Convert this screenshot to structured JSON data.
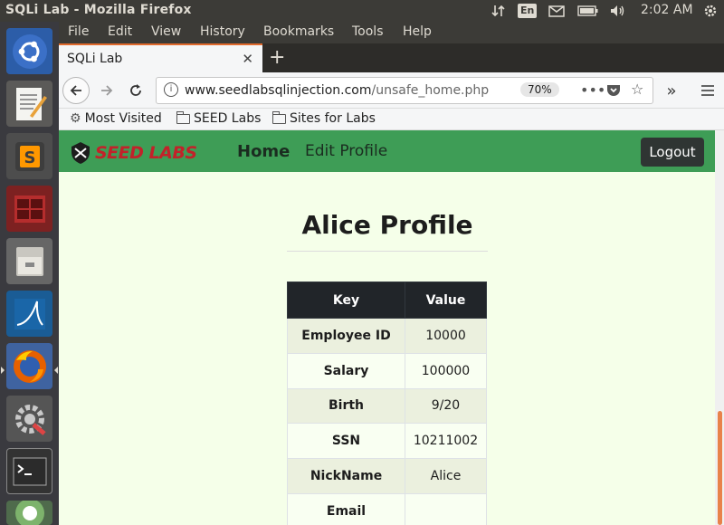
{
  "system": {
    "window_title": "SQLi Lab - Mozilla Firefox",
    "keyboard_layout": "En",
    "clock": "2:02 AM"
  },
  "launcher": {
    "apps": [
      {
        "name": "ubuntu-dash-icon"
      },
      {
        "name": "text-editor-icon"
      },
      {
        "name": "sublime-text-icon"
      },
      {
        "name": "terminal-red-icon"
      },
      {
        "name": "file-archive-icon"
      },
      {
        "name": "wireshark-icon"
      },
      {
        "name": "firefox-icon",
        "running": true
      },
      {
        "name": "settings-icon"
      },
      {
        "name": "terminal-icon"
      },
      {
        "name": "software-updater-icon"
      }
    ]
  },
  "browser": {
    "menu": [
      "File",
      "Edit",
      "View",
      "History",
      "Bookmarks",
      "Tools",
      "Help"
    ],
    "tab_title": "SQLi Lab",
    "url_host": "www.seedlabsqlinjection.com",
    "url_path": "/unsafe_home.php",
    "zoom": "70%",
    "bookmarks": [
      "Most Visited",
      "SEED Labs",
      "Sites for Labs"
    ]
  },
  "site": {
    "logo_text": "SEED LABS",
    "nav": {
      "home": "Home",
      "edit": "Edit Profile",
      "logout": "Logout"
    },
    "title": "Alice Profile",
    "table": {
      "headers": [
        "Key",
        "Value"
      ],
      "rows": [
        {
          "key": "Employee ID",
          "value": "10000"
        },
        {
          "key": "Salary",
          "value": "100000"
        },
        {
          "key": "Birth",
          "value": "9/20"
        },
        {
          "key": "SSN",
          "value": "10211002"
        },
        {
          "key": "NickName",
          "value": "Alice"
        },
        {
          "key": "Email",
          "value": ""
        }
      ]
    }
  },
  "colors": {
    "nav_green": "#3e9d56",
    "page_bg": "#f5ffe9",
    "table_head": "#212529",
    "tab_accent": "#e16a2d"
  }
}
